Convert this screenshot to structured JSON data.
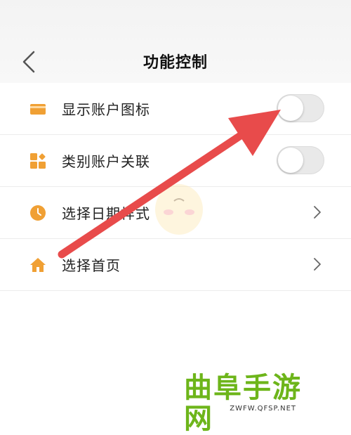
{
  "header": {
    "title": "功能控制"
  },
  "list": [
    {
      "label": "显示账户图标",
      "icon": "card-icon",
      "control": "toggle",
      "toggle_on": false
    },
    {
      "label": "类别账户关联",
      "icon": "category-icon",
      "control": "toggle",
      "toggle_on": false
    },
    {
      "label": "选择日期样式",
      "icon": "clock-icon",
      "control": "chevron"
    },
    {
      "label": "选择首页",
      "icon": "home-icon",
      "control": "chevron"
    }
  ],
  "colors": {
    "icon_orange": "#f0a034",
    "arrow_red": "#e84b4b",
    "watermark_green": "#6db51a"
  },
  "watermark": {
    "text": "曲阜手游网",
    "url": "ZWFW.QFSP.NET"
  }
}
